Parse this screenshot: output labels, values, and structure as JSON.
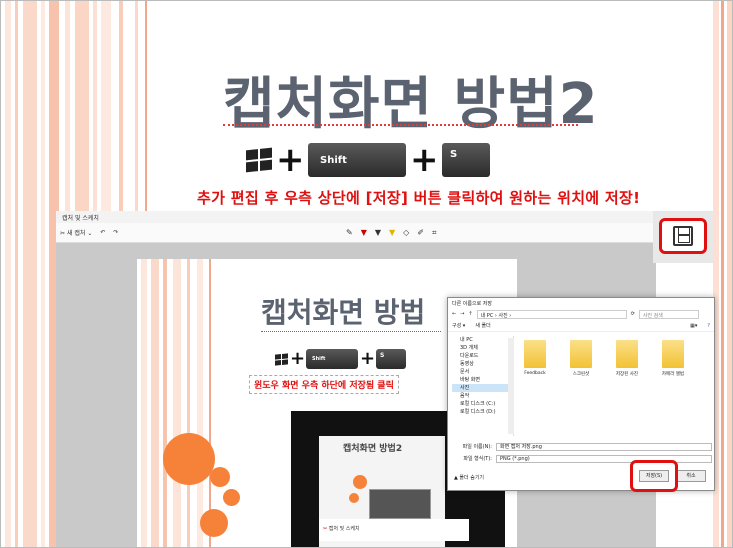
{
  "slide": {
    "title": "캡처화면 방법2",
    "keys": {
      "shift": "Shift",
      "s": "S"
    },
    "plus": "+",
    "instruction": "추가 편집 후 우측 상단에 [저장] 버튼 클릭하여 원하는 위치에 저장!"
  },
  "snip_window": {
    "title": "캡처 및 스케치",
    "new_button": "새 캡처",
    "tools": [
      "✎",
      "▼",
      "▼",
      "▼",
      "◇",
      "✐",
      "⌗"
    ]
  },
  "inner_slide": {
    "title": "캡처화면 방법",
    "keys": {
      "shift": "Shift",
      "s": "S"
    },
    "plus": "+",
    "instruction": "윈도우 화면 우측 하단에 저장됨 클릭"
  },
  "nested": {
    "title": "캡처화면 방법2",
    "footer": "캡처 및 스케치"
  },
  "dialog": {
    "title": "다른 이름으로 저장",
    "path": "내 PC › 사진 ›",
    "search": "사진 검색",
    "organize": "구성 ▾",
    "new_folder": "새 폴더",
    "tree": [
      "내 PC",
      "3D 개체",
      "다운로드",
      "동영상",
      "문서",
      "바탕 화면",
      "사진",
      "음악",
      "로컬 디스크 (C:)",
      "로컬 디스크 (D:)"
    ],
    "files": [
      "Feedback",
      "스크린샷",
      "저장된 사진",
      "카메라 앨범"
    ],
    "filename_label": "파일 이름(N):",
    "filename_value": "화면 캡처 저장.png",
    "filetype_label": "파일 형식(T):",
    "filetype_value": "PNG (*.png)",
    "hide_folders": "▲ 폴더 숨기기",
    "save_button": "저장(S)",
    "cancel_button": "취소"
  },
  "colors": {
    "accent_red": "#e01010",
    "title_gray": "#5b6270",
    "circle_orange": "#f6823a",
    "folder_yellow": "#f2c233"
  }
}
